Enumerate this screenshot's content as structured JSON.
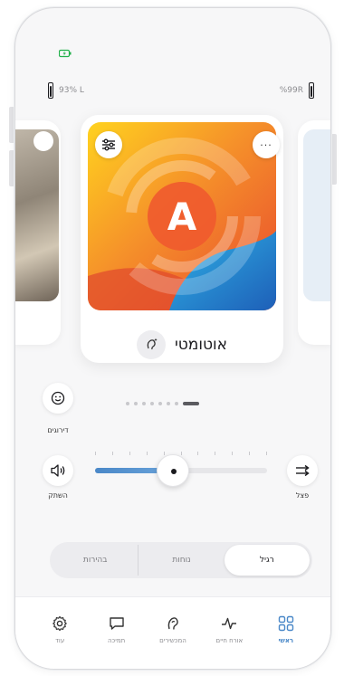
{
  "status": {
    "icon": "battery-charging-icon"
  },
  "levels": {
    "left": "93% L",
    "right": "%99R"
  },
  "program": {
    "name": "אוטומטי",
    "badge_letter": "A",
    "adjust_icon": "sliders-icon",
    "more_icon": "more-icon",
    "more_text": "···",
    "type_icon": "ear-auto-icon"
  },
  "feedback": {
    "label": "דירוגים",
    "icon": "smiley-icon"
  },
  "pager": {
    "count": 8,
    "active_index": 7
  },
  "volume": {
    "mute_label": "השתק",
    "split_label": "פצל",
    "level": 0.45,
    "tick_count": 11
  },
  "environment": {
    "options": [
      "רגיל",
      "נוחות",
      "בהירות"
    ],
    "active": "רגיל"
  },
  "tabs": [
    {
      "label": "ראשי",
      "icon": "grid-icon",
      "active": true
    },
    {
      "label": "אורח חיים",
      "icon": "activity-icon",
      "active": false
    },
    {
      "label": "המכשירים",
      "icon": "ear-icon",
      "active": false
    },
    {
      "label": "תמיכה",
      "icon": "chat-icon",
      "active": false
    },
    {
      "label": "עוד",
      "icon": "gear-icon",
      "active": false
    }
  ],
  "colors": {
    "accent": "#4a88c8",
    "active_tab": "#4a88c8",
    "card_orange": "#f5902a",
    "card_blue": "#2a7fd0"
  }
}
